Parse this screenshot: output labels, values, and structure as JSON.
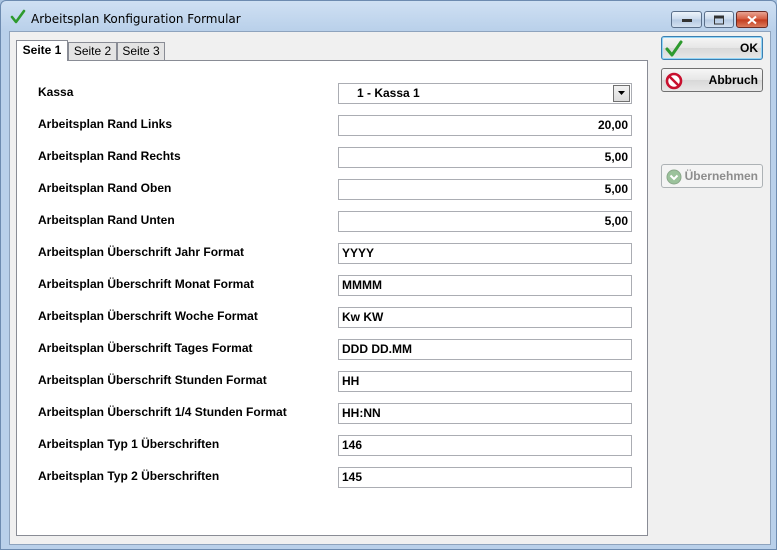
{
  "window": {
    "title": "Arbeitsplan Konfiguration Formular"
  },
  "tabs": [
    {
      "label": "Seite 1",
      "active": true
    },
    {
      "label": "Seite 2",
      "active": false
    },
    {
      "label": "Seite 3",
      "active": false
    }
  ],
  "form": {
    "kassa": {
      "label": "Kassa",
      "value": "1 - Kassa 1"
    },
    "rows": [
      {
        "label": "Arbeitsplan Rand Links",
        "value": "20,00"
      },
      {
        "label": "Arbeitsplan Rand Rechts",
        "value": "5,00"
      },
      {
        "label": "Arbeitsplan Rand Oben",
        "value": "5,00"
      },
      {
        "label": "Arbeitsplan Rand Unten",
        "value": "5,00"
      },
      {
        "label": "Arbeitsplan Überschrift Jahr Format",
        "value": "YYYY"
      },
      {
        "label": "Arbeitsplan Überschrift Monat Format",
        "value": "MMMM"
      },
      {
        "label": "Arbeitsplan Überschrift Woche Format",
        "value": "Kw KW"
      },
      {
        "label": "Arbeitsplan Überschrift Tages Format",
        "value": "DDD DD.MM"
      },
      {
        "label": "Arbeitsplan Überschrift Stunden Format",
        "value": "HH"
      },
      {
        "label": "Arbeitsplan Überschrift 1/4 Stunden Format",
        "value": "HH:NN"
      },
      {
        "label": "Arbeitsplan Typ 1 Überschriften",
        "value": "146"
      },
      {
        "label": "Arbeitsplan Typ 2 Überschriften",
        "value": "145"
      }
    ]
  },
  "buttons": {
    "ok": "OK",
    "cancel": "Abbruch",
    "apply": "Übernehmen"
  },
  "icons": {
    "title": "checkmark-icon",
    "ok": "checkmark-icon",
    "cancel": "no-entry-icon",
    "apply": "chevron-down-circle-icon"
  },
  "colors": {
    "check_green": "#2e9a2e",
    "cancel_red": "#c8102e",
    "disabled_text": "#8d8d8d"
  }
}
